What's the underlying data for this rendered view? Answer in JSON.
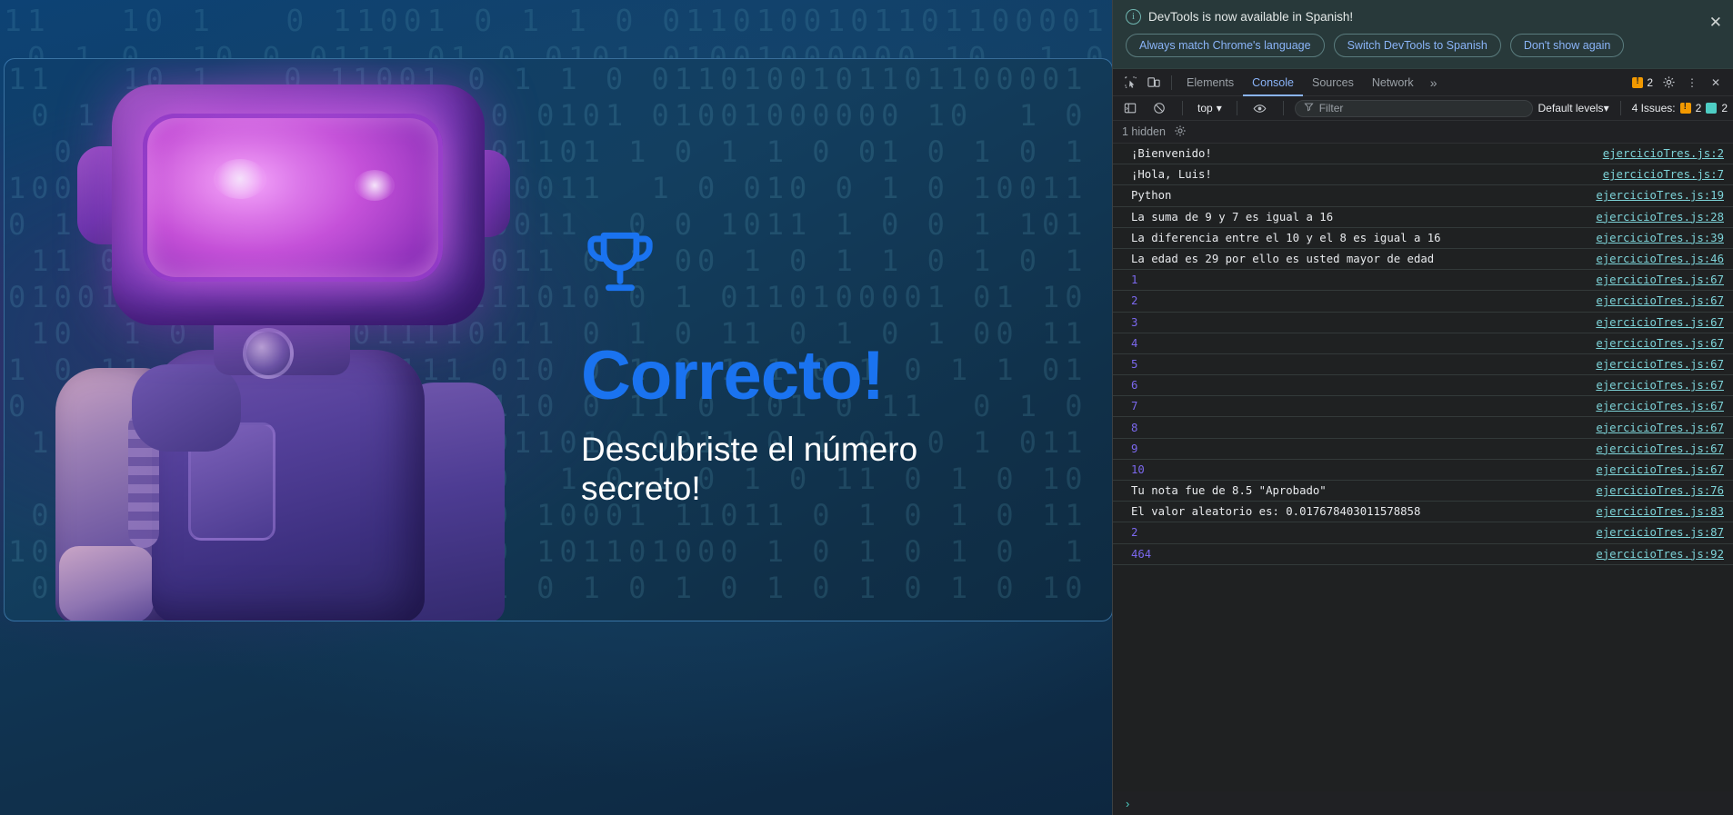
{
  "page": {
    "hero": {
      "trophy_icon": "trophy-icon",
      "title": "Correcto!",
      "title_color": "#1a73f0",
      "subtitle": "Descubriste el número secreto!"
    },
    "background_binary_rows": [
      "11   10 1   0 11001 0 1 1 0 0110100101101100001",
      " 0 1 0  10 0 0111 01 0 0101 01001000000 10  1 0",
      "  0  1 1 0 1 0  011 101101 1 0 1 1 0 01 0 1 0 1",
      "1001 11 0 0 00011000000011  1 0 010 0 1 0 10011",
      "0 1 0 10 1 10001 0 100011  0 0 1011 1 0 0 1 101",
      " 11 0 01 0 1 1000110 011 0 1 00 1 0 1 1 0 1 0 1",
      "01001 1 0 11 0 11111111010 0 1 0110100001 01 10",
      " 10  1 0 1 00 1011110111 0 1 0 11 0 1 0 1 00 11",
      "1 0 11 00 0010 11111 010 0 1 0 1 1 0 1 0 1 1 01",
      "0 000 1 0 11101100 0 110 0 11 0 101 0 11  0 1 0",
      " 10 1 0 11 0 010110 0011010 0011 0 1 01 0 1 011",
      "  0 1 0 1 011000010 00  1 0 1 0 1 0 11 0 1 0 10",
      " 0 11  1 0 1 0 1 0 110 10001 11011 0 1 0 1 0 11",
      "10100 010 11 101101000 101101000 1 0 1 0 1 0  1",
      " 0 1 0 1 0 1 0 1 1 0 1 0 1 0 1 0 1 0 1 0 1 0 10"
    ]
  },
  "devtools": {
    "banner": {
      "info_icon": "info-circle-icon",
      "message": "DevTools is now available in Spanish!",
      "buttons": [
        {
          "label": "Always match Chrome's language",
          "name": "always-match-language-button"
        },
        {
          "label": "Switch DevTools to Spanish",
          "name": "switch-to-spanish-button"
        },
        {
          "label": "Don't show again",
          "name": "dont-show-again-button"
        }
      ],
      "close_icon": "✕"
    },
    "tabstrip": {
      "inspect_icon": "inspect-element-icon",
      "device_icon": "device-toolbar-icon",
      "tabs": [
        {
          "label": "Elements",
          "active": false
        },
        {
          "label": "Console",
          "active": true
        },
        {
          "label": "Sources",
          "active": false
        },
        {
          "label": "Network",
          "active": false
        }
      ],
      "more_tabs_icon": "»",
      "warning_count": "2",
      "settings_icon": "gear-icon",
      "menu_icon": "⋮",
      "close_icon": "✕"
    },
    "console_toolbar": {
      "sidebar_icon": "console-sidebar-icon",
      "clear_icon": "clear-console-icon",
      "context": "top",
      "context_caret": "▾",
      "eye_icon": "live-expression-icon",
      "filter_icon": "filter-funnel-icon",
      "filter_placeholder": "Filter",
      "filter_value": "",
      "levels_label": "Default levels",
      "levels_caret": "▾",
      "issues_label": "4 Issues:",
      "issues_warning_count": "2",
      "issues_info_count": "2"
    },
    "hidden_row": {
      "label": "1 hidden",
      "settings_icon": "gear-icon"
    },
    "messages": [
      {
        "text": "¡Bienvenido!",
        "type": "string",
        "source": "ejercicioTres.js:2"
      },
      {
        "text": "¡Hola, Luis!",
        "type": "string",
        "source": "ejercicioTres.js:7"
      },
      {
        "text": "Python",
        "type": "string",
        "source": "ejercicioTres.js:19"
      },
      {
        "text": "La suma de 9 y 7 es igual a 16",
        "type": "string",
        "source": "ejercicioTres.js:28"
      },
      {
        "text": "La diferencia entre el 10 y el 8 es igual a 16",
        "type": "string",
        "source": "ejercicioTres.js:39"
      },
      {
        "text": "La edad es 29 por ello es usted mayor de edad",
        "type": "string",
        "source": "ejercicioTres.js:46"
      },
      {
        "text": "1",
        "type": "number",
        "source": "ejercicioTres.js:67"
      },
      {
        "text": "2",
        "type": "number",
        "source": "ejercicioTres.js:67"
      },
      {
        "text": "3",
        "type": "number",
        "source": "ejercicioTres.js:67"
      },
      {
        "text": "4",
        "type": "number",
        "source": "ejercicioTres.js:67"
      },
      {
        "text": "5",
        "type": "number",
        "source": "ejercicioTres.js:67"
      },
      {
        "text": "6",
        "type": "number",
        "source": "ejercicioTres.js:67"
      },
      {
        "text": "7",
        "type": "number",
        "source": "ejercicioTres.js:67"
      },
      {
        "text": "8",
        "type": "number",
        "source": "ejercicioTres.js:67"
      },
      {
        "text": "9",
        "type": "number",
        "source": "ejercicioTres.js:67"
      },
      {
        "text": "10",
        "type": "number",
        "source": "ejercicioTres.js:67"
      },
      {
        "text": "Tu nota fue de 8.5 \"Aprobado\"",
        "type": "string",
        "source": "ejercicioTres.js:76"
      },
      {
        "text": "El valor aleatorio es: 0.017678403011578858",
        "type": "string",
        "source": "ejercicioTres.js:83"
      },
      {
        "text": "2",
        "type": "number",
        "source": "ejercicioTres.js:87"
      },
      {
        "text": "464",
        "type": "number",
        "source": "ejercicioTres.js:92"
      }
    ],
    "prompt_symbol": "›"
  }
}
